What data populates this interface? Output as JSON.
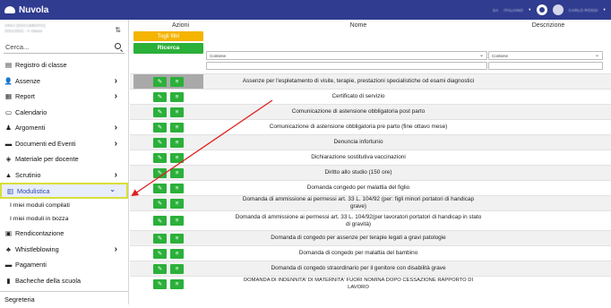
{
  "app": {
    "title": "Nuvola",
    "language": "ITALIANO",
    "user": "CARLO ROSSI",
    "year": "SA"
  },
  "school": {
    "line1": "VINCI (DOCUMENTO)",
    "line2": "2021/2022 - V classe"
  },
  "search": {
    "placeholder": "Cerca..."
  },
  "sidebar": {
    "items": [
      {
        "label": "Registro di classe",
        "icon": "register-icon",
        "chevron": false
      },
      {
        "label": "Assenze",
        "icon": "user-minus-icon",
        "chevron": true
      },
      {
        "label": "Report",
        "icon": "report-icon",
        "chevron": true
      },
      {
        "label": "Calendario",
        "icon": "calendar-icon",
        "chevron": false
      },
      {
        "label": "Argomenti",
        "icon": "topics-icon",
        "chevron": true
      },
      {
        "label": "Documenti ed Eventi",
        "icon": "folder-icon",
        "chevron": true
      },
      {
        "label": "Materiale per docente",
        "icon": "material-icon",
        "chevron": false
      },
      {
        "label": "Scrutinio",
        "icon": "graduation-icon",
        "chevron": true
      },
      {
        "label": "Modulistica",
        "icon": "building-icon",
        "chevron": true,
        "active": true
      }
    ],
    "subitems": [
      "I miei moduli compilati",
      "I miei moduli in bozza"
    ],
    "items2": [
      {
        "label": "Rendicontazione",
        "icon": "report-icon",
        "chevron": false
      },
      {
        "label": "Whistleblowing",
        "icon": "whistle-icon",
        "chevron": true
      },
      {
        "label": "Pagamenti",
        "icon": "card-icon",
        "chevron": false
      },
      {
        "label": "Bacheche della scuola",
        "icon": "board-icon",
        "chevron": false
      }
    ],
    "footer": "Segreteria"
  },
  "table": {
    "headers": {
      "actions": "Azioni",
      "name": "Nome",
      "description": "Descrizione"
    },
    "filter_button": "Togli filtri",
    "search_button": "Ricerca",
    "name_filter": "Contiene",
    "desc_filter": "Contiene",
    "rows": [
      "Assenze per l'espletamento di visite, terapie, prestazioni specialistiche od esami diagnostici",
      "Certificato di servizio",
      "Comunicazione di astensione obbligatoria post parto",
      "Comunicazione di astensione obbligatoria pre parto (fine ottavo mese)",
      "Denuncia infortunio",
      "Dichiarazione sostitutiva vaccinazioni",
      "Diritto allo studio (150 ore)",
      "Domanda congedo per malattia del figlio",
      "Domanda di ammissione ai permessi art. 33 L. 104/92 (per: figli minori portatori di handicap grave)",
      "Domanda di ammissione ai permessi art. 33 L. 104/92(per lavoratori portatori di handicap in stato di gravità)",
      "Domanda di congedo per assenze per terapie legati a gravi patologie",
      "Domanda di congedo per malattia del bambino",
      "Domanda di congedo straordinario per il genitore con disabilità grave",
      "DOMANDA DI INDENNITA' DI MATERNITA' FUORI NOMINA DOPO CESSAZIONE RAPPORTO DI LAVORO"
    ]
  },
  "colors": {
    "topbar": "#2f3c8f",
    "accent_green": "#2bb03a",
    "accent_yellow": "#f4b400",
    "annotation_arrow": "#e02020",
    "active_highlight": "#d7df3a"
  }
}
